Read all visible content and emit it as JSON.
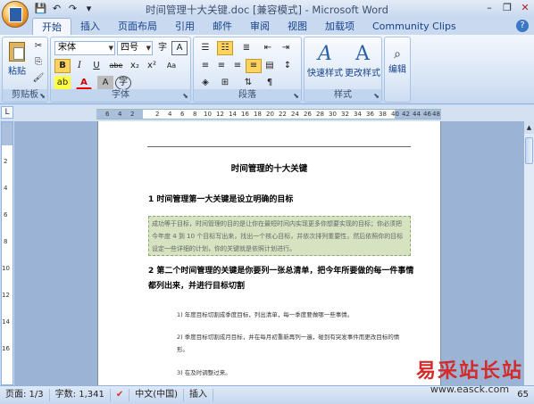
{
  "window": {
    "title": "时间管理十大关键.doc [兼容模式] - Microsoft Word",
    "minimize_glyph": "–",
    "maximize_glyph": "❐",
    "close_glyph": "✕"
  },
  "quick_access": {
    "save_icon": "save-icon",
    "undo_icon": "undo-icon",
    "redo_icon": "redo-icon"
  },
  "tabs": [
    "开始",
    "插入",
    "页面布局",
    "引用",
    "邮件",
    "审阅",
    "视图",
    "加载项",
    "Community Clips"
  ],
  "ribbon": {
    "clipboard": {
      "label": "剪贴板",
      "paste_label": "粘贴"
    },
    "font": {
      "label": "字体",
      "font_name": "宋体",
      "font_size": "四号",
      "bold": "B",
      "italic": "I",
      "underline": "U",
      "strike": "abe",
      "subscript": "x₂",
      "superscript": "x²",
      "clear_format": "Aa",
      "font_color": "A",
      "char_shading": "A",
      "char_border": "A",
      "phonetic": "字",
      "enclosed": "字"
    },
    "paragraph": {
      "label": "段落"
    },
    "styles": {
      "label": "样式",
      "quick_styles": "快速样式",
      "change_styles": "更改样式"
    },
    "editing": {
      "label": "编辑"
    }
  },
  "ruler": {
    "ticks": [
      "6",
      "4",
      "2",
      "",
      "2",
      "4",
      "6",
      "8",
      "10",
      "12",
      "14",
      "16",
      "18",
      "20",
      "22",
      "24",
      "26",
      "28",
      "30",
      "32",
      "34",
      "36",
      "38",
      "40",
      "42",
      "44",
      "46",
      "48"
    ],
    "vticks": [
      "2",
      "4",
      "6",
      "8",
      "10",
      "12",
      "14",
      "16"
    ]
  },
  "document": {
    "title": "时间管理的十大关键",
    "heading1": "1  时间管理第一大关键是设立明确的目标",
    "shaded_text": "成功等于目标，时间管理的目的是让你在最短时间内实现更多你想要实现的目标；你必须把今年度 4 到 10 个目标写出来，找出一个核心目标，并依次排列重要性，然后依照你的目标设定一些详细的计划，你的关键就是依照计划进行。",
    "heading2": "2  第二个时间管理的关键是你要列一张总清单，把今年所要做的每一件事情都列出来，并进行目标切割",
    "items": [
      "1) 年度目标切割成季度目标，列出清单，每一季度要做哪一些事情。",
      "2) 季度目标切割成月目标，并在每月初重新再列一遍，碰到有突发事件而更改目标的情形。",
      "3) 在及时调整过来。"
    ]
  },
  "statusbar": {
    "page": "页面: 1/3",
    "words": "字数: 1,341",
    "language": "中文(中国)",
    "mode": "插入",
    "zoom": "65"
  },
  "watermark": {
    "line1": "易采站长站",
    "line2": "www.easck.com"
  },
  "colors": {
    "ribbon_bg": "#d5e3f5",
    "title_text": "#3b4f6e",
    "shaded": "#d5e3c1",
    "watermark_red": "#d32a2a"
  }
}
